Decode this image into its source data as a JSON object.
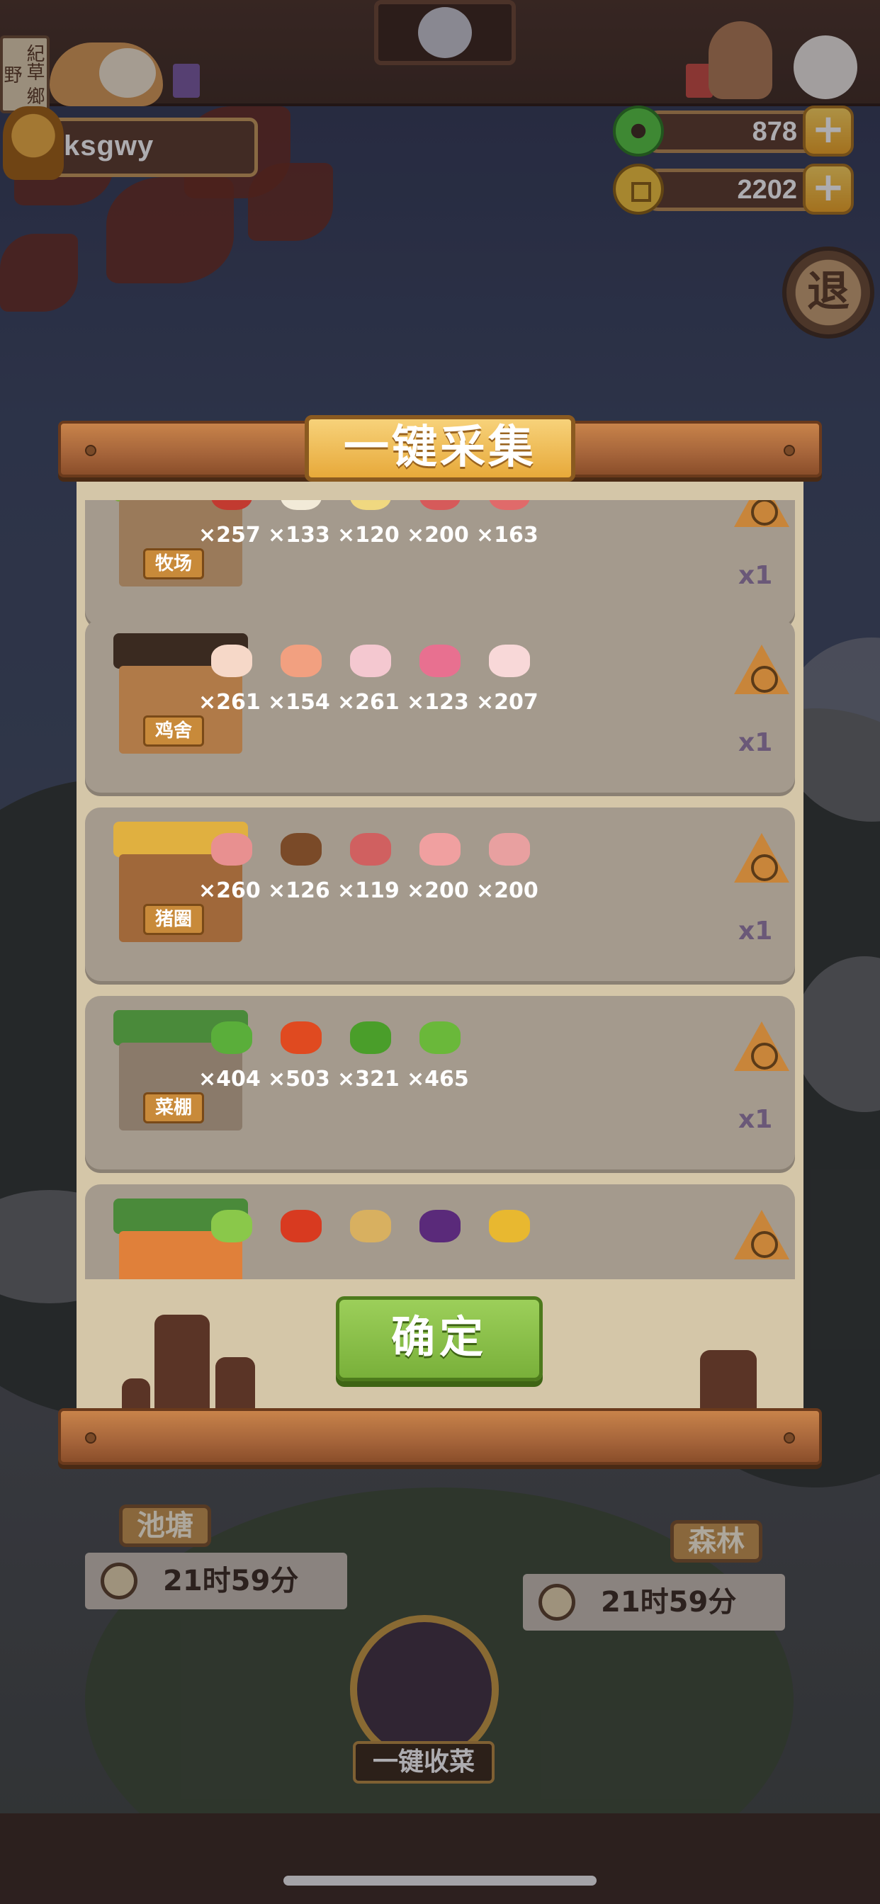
{
  "hud": {
    "left_sign_text": "紀草 鄉野",
    "player_name": "ksgwy",
    "jade_value": "878",
    "coin_value": "2202",
    "plus_symbol": "+",
    "exit_label": "退"
  },
  "scene": {
    "pond_label": "池塘",
    "pond_timer": "21时59分",
    "forest_label": "森林",
    "forest_timer": "21时59分",
    "harvest_label": "一键收菜"
  },
  "modal": {
    "title": "一键采集",
    "confirm_label": "确定",
    "cards": [
      {
        "building_label": "牧场",
        "multiplier": "x1",
        "items": [
          {
            "icon": "red-meat-icon",
            "count": "×257",
            "color": "#c23a30"
          },
          {
            "icon": "milk-bottle-icon",
            "count": "×133",
            "color": "#f2ead8"
          },
          {
            "icon": "cheese-plate-icon",
            "count": "×120",
            "color": "#f0d880"
          },
          {
            "icon": "mutton-icon",
            "count": "×200",
            "color": "#d65a5a"
          },
          {
            "icon": "beef-slice-icon",
            "count": "×163",
            "color": "#e06a6a"
          }
        ]
      },
      {
        "building_label": "鸡舍",
        "multiplier": "x1",
        "items": [
          {
            "icon": "egg-icon",
            "count": "×261",
            "color": "#f6d8c8"
          },
          {
            "icon": "chicken-breast-icon",
            "count": "×154",
            "color": "#f2a080"
          },
          {
            "icon": "whole-chicken-icon",
            "count": "×261",
            "color": "#f4c8d0"
          },
          {
            "icon": "chicken-wing-icon",
            "count": "×123",
            "color": "#e87090"
          },
          {
            "icon": "drumstick-icon",
            "count": "×207",
            "color": "#f8d8d8"
          }
        ]
      },
      {
        "building_label": "猪圈",
        "multiplier": "x1",
        "items": [
          {
            "icon": "bacon-icon",
            "count": "×260",
            "color": "#e89090"
          },
          {
            "icon": "lard-bowl-icon",
            "count": "×126",
            "color": "#7a4a28"
          },
          {
            "icon": "pork-chop-icon",
            "count": "×119",
            "color": "#d06060"
          },
          {
            "icon": "pork-belly-icon",
            "count": "×200",
            "color": "#f0a0a0"
          },
          {
            "icon": "ham-icon",
            "count": "×200",
            "color": "#e8a0a0"
          }
        ]
      },
      {
        "building_label": "菜棚",
        "multiplier": "x1",
        "items": [
          {
            "icon": "bok-choy-icon",
            "count": "×404",
            "color": "#5aae3a"
          },
          {
            "icon": "tomato-icon",
            "count": "×503",
            "color": "#e04a20"
          },
          {
            "icon": "green-pepper-icon",
            "count": "×321",
            "color": "#4a9e2a"
          },
          {
            "icon": "cucumber-icon",
            "count": "×465",
            "color": "#6ab83a"
          }
        ]
      },
      {
        "building_label": "",
        "multiplier": "",
        "items": [
          {
            "icon": "leek-icon",
            "count": "",
            "color": "#8ac84a"
          },
          {
            "icon": "chili-icon",
            "count": "",
            "color": "#d83a20"
          },
          {
            "icon": "potato-icon",
            "count": "",
            "color": "#d8b060"
          },
          {
            "icon": "eggplant-icon",
            "count": "",
            "color": "#5a2a7a"
          },
          {
            "icon": "pineapple-icon",
            "count": "",
            "color": "#e8b830"
          }
        ]
      }
    ]
  }
}
